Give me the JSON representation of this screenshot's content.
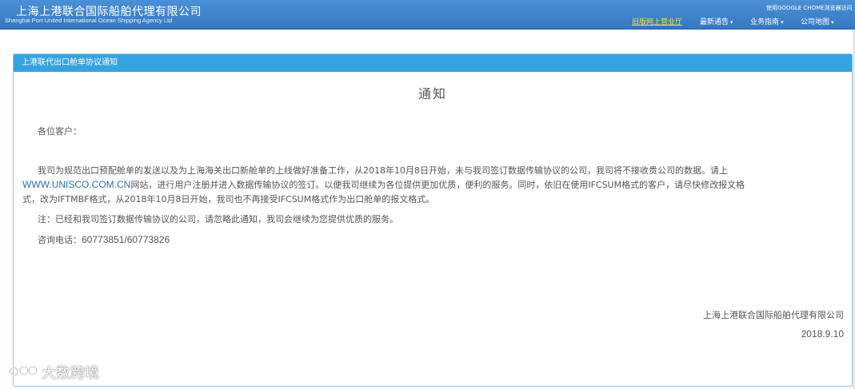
{
  "header": {
    "company_cn": "上海上港联合国际船舶代理有限公司",
    "company_en": "Shanghai Port United International Ocean Shipping Agency Ltd",
    "browser_tip": "使用GOOGLE CHOME浏览器访问",
    "nav": {
      "old_hall": "旧版网上营业厅",
      "latest_notice": "最新通告",
      "business_guide": "业务指南",
      "company_map": "公司地图"
    }
  },
  "panel": {
    "heading": "上港联代出口舱单协议通知",
    "title": "通知",
    "greeting": "各位客户：",
    "para1_line1": "我司为规范出口预配舱单的发送以及为上海海关出口新舱单的上线做好准备工作，从2018年10月8日开始，未与我司签订数据传输协议的公司，我司将不接收贵公司的数据。请上",
    "para1_link": "WWW.UNISCO.COM.CN",
    "para1_line2_rest": "网站，进行用户注册并进入数据传输协议的签订。以便我司继续为各位提供更加优质，便利的服务。同时，依旧在使用IFCSUM格式的客户，请尽快修改报文格",
    "para1_line3": "式，改为IFTMBF格式，从2018年10月8日开始，我司也不再接受IFCSUM格式作为出口舱单的报文格式。",
    "note": "注：已经和我司签订数据传输协议的公司，请忽略此通知，我司会继续为您提供优质的服务。",
    "phone_label": "咨询电话：",
    "phone_number": "60773851/60773826",
    "signature": "上海上港联合国际船舶代理有限公司",
    "date": "2018.9.10"
  },
  "watermark": {
    "text": "大数跨境"
  }
}
